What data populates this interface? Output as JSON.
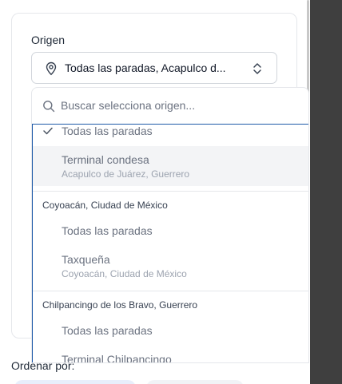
{
  "form": {
    "origin_label": "Origen",
    "origin_value": "Todas las paradas, Acapulco d...",
    "sort_label": "Ordenar por:"
  },
  "dropdown": {
    "search_placeholder": "Buscar selecciona origen...",
    "items": [
      {
        "title": "Todas las paradas",
        "selected": true
      },
      {
        "title": "Terminal condesa",
        "subtitle": "Acapulco de Juárez, Guerrero"
      },
      {
        "group": "Coyoacán, Ciudad de México"
      },
      {
        "title": "Todas las paradas"
      },
      {
        "title": "Taxqueña",
        "subtitle": "Coyoacán, Ciudad de México"
      },
      {
        "group": "Chilpancingo de los Bravo, Guerrero"
      },
      {
        "title": "Todas las paradas"
      },
      {
        "title": "Terminal Chilpancingo"
      }
    ]
  },
  "icons": {
    "location": "map-pin-icon",
    "chevrons": "chevron-up-down-icon",
    "search": "search-icon",
    "selected": "check-icon"
  },
  "colors": {
    "focus_border": "#1e5aa8",
    "muted_text": "#6b7280",
    "highlight_bg": "#f3f4f6"
  }
}
